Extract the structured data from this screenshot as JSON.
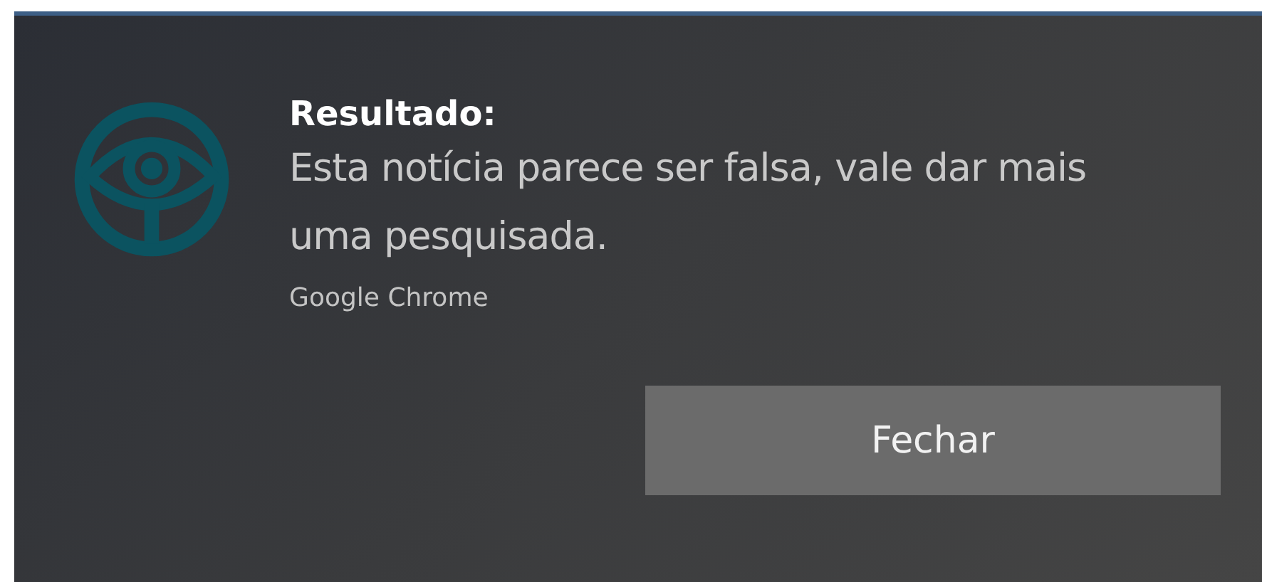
{
  "notification": {
    "title": "Resultado:",
    "message": "Esta notícia parece ser falsa, vale dar mais uma pesquisada.",
    "source": "Google Chrome",
    "buttons": [
      "Fechar"
    ]
  }
}
